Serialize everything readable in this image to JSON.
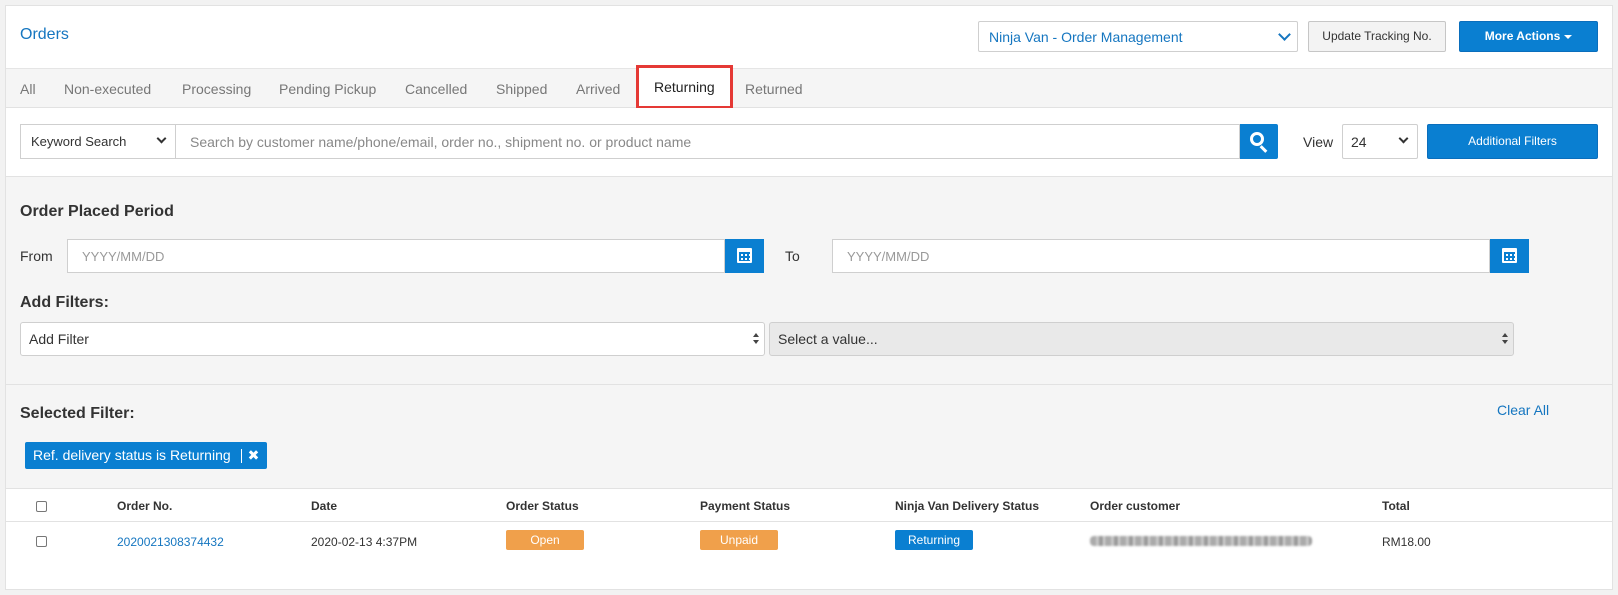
{
  "header": {
    "title": "Orders",
    "app_select": "Ninja Van - Order Management",
    "update_tracking_label": "Update Tracking No.",
    "more_actions_label": "More Actions"
  },
  "tabs": [
    {
      "label": "All"
    },
    {
      "label": "Non-executed"
    },
    {
      "label": "Processing"
    },
    {
      "label": "Pending Pickup"
    },
    {
      "label": "Cancelled"
    },
    {
      "label": "Shipped"
    },
    {
      "label": "Arrived"
    },
    {
      "label": "Returning",
      "active": true
    },
    {
      "label": "Returned"
    }
  ],
  "search": {
    "keyword_select": "Keyword Search",
    "placeholder": "Search by customer name/phone/email, order no., shipment no. or product name",
    "view_label": "View",
    "view_value": "24",
    "additional_filters_label": "Additional Filters"
  },
  "period": {
    "title": "Order Placed Period",
    "from_label": "From",
    "to_label": "To",
    "from_placeholder": "YYYY/MM/DD",
    "to_placeholder": "YYYY/MM/DD"
  },
  "add_filters": {
    "title": "Add Filters:",
    "filter_select": "Add Filter",
    "value_select": "Select a value..."
  },
  "selected_filter": {
    "title": "Selected Filter:",
    "clear_all_label": "Clear All",
    "chip_label": "Ref. delivery status is Returning",
    "chip_remove": "✖"
  },
  "table": {
    "columns": [
      "Order No.",
      "Date",
      "Order Status",
      "Payment Status",
      "Ninja Van Delivery Status",
      "Order customer",
      "Total"
    ],
    "rows": [
      {
        "order_no": "2020021308374432",
        "date": "2020-02-13 4:37PM",
        "order_status": "Open",
        "payment_status": "Unpaid",
        "delivery_status": "Returning",
        "total": "RM18.00"
      }
    ]
  },
  "colors": {
    "accent_blue": "#0a7fd1",
    "link_blue": "#1576c0",
    "status_orange": "#f0a04b",
    "highlight_red": "#e53935"
  }
}
